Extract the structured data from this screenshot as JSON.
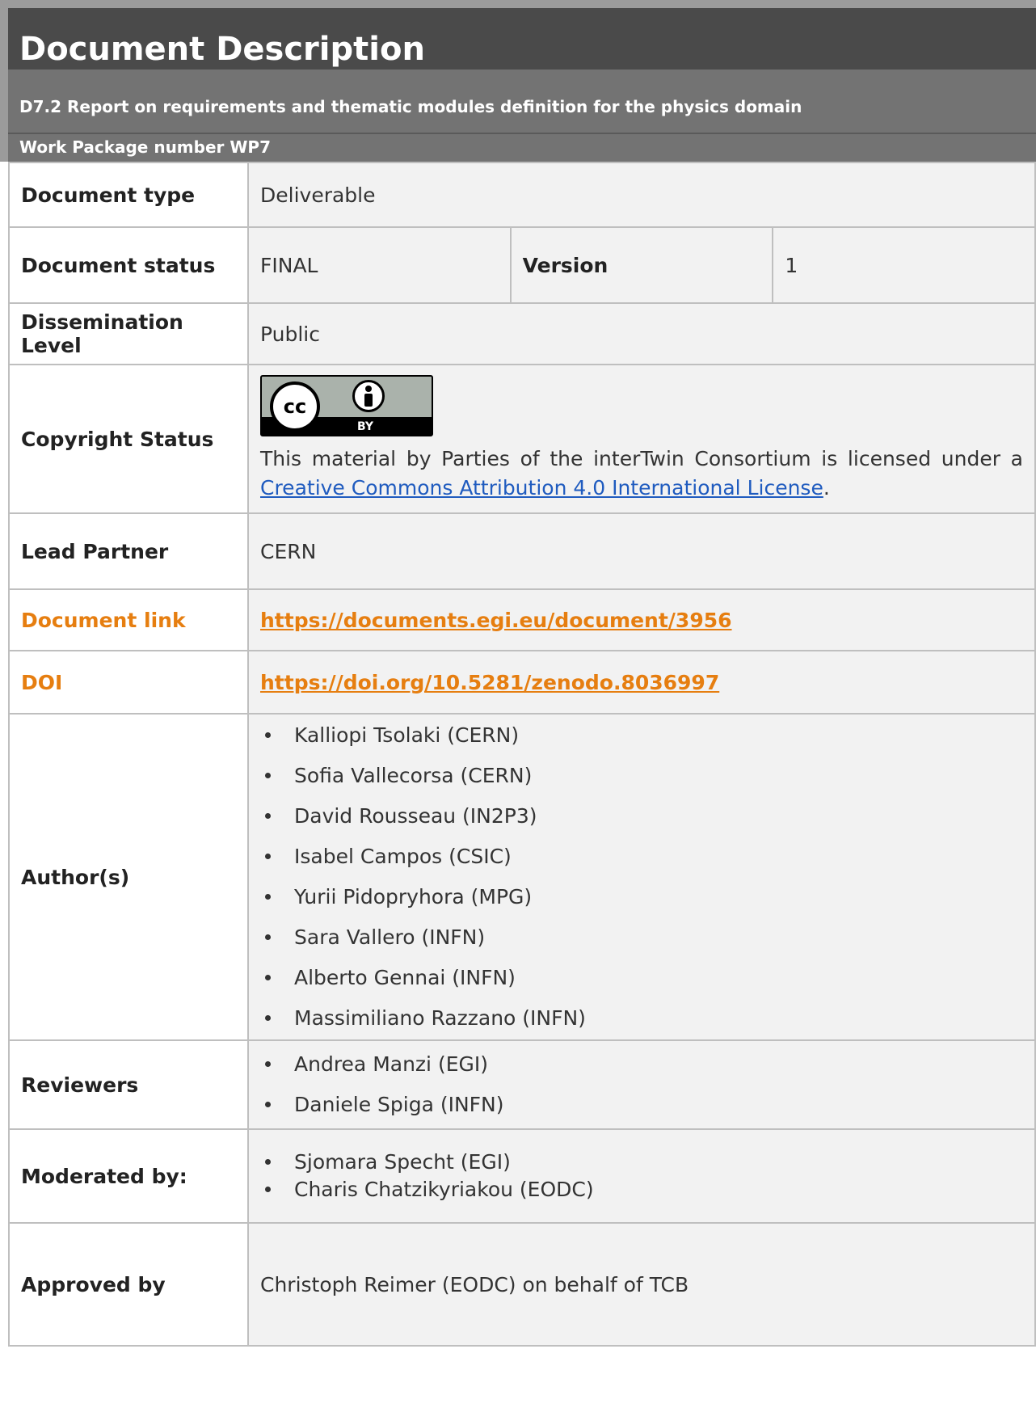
{
  "header": {
    "title": "Document Description",
    "subtitle": "D7.2 Report on requirements and thematic modules definition for the physics domain",
    "work_package": "Work Package number WP7"
  },
  "rows": {
    "type_label": "Document type",
    "type_value": "Deliverable",
    "status_label": "Document status",
    "status_value": "FINAL",
    "version_label": "Version",
    "version_value": "1",
    "dissemination_label": "Dissemination Level",
    "dissemination_value": "Public",
    "copyright_label": "Copyright Status",
    "license_badge": {
      "cc": "cc",
      "by": "BY"
    },
    "license_text_before": "This material by Parties of the interTwin Consortium is licensed under a ",
    "license_link": "Creative Commons Attribution 4.0 International License",
    "license_text_after": ".",
    "lead_label": "Lead Partner",
    "lead_value": "CERN",
    "doclink_label": "Document link",
    "doclink_value": "https://documents.egi.eu/document/3956",
    "doi_label": "DOI",
    "doi_value": "https://doi.org/10.5281/zenodo.8036997",
    "authors_label": "Author(s)",
    "authors": [
      "Kalliopi Tsolaki (CERN)",
      "Sofia Vallecorsa (CERN)",
      "David Rousseau (IN2P3)",
      "Isabel Campos (CSIC)",
      "Yurii Pidopryhora (MPG)",
      "Sara Vallero (INFN)",
      "Alberto Gennai (INFN)",
      "Massimiliano Razzano (INFN)"
    ],
    "reviewers_label": "Reviewers",
    "reviewers": [
      "Andrea Manzi (EGI)",
      "Daniele Spiga (INFN)"
    ],
    "moderated_label": "Moderated by:",
    "moderators": [
      "Sjomara Specht (EGI)",
      "Charis Chatzikyriakou (EODC)"
    ],
    "approved_label": "Approved by",
    "approved_value": "Christoph Reimer (EODC) on behalf of TCB"
  },
  "colors": {
    "header_dark": "#4a4a4a",
    "header_band": "#737373",
    "link_orange": "#e67e10",
    "link_blue": "#1f5bbf"
  }
}
